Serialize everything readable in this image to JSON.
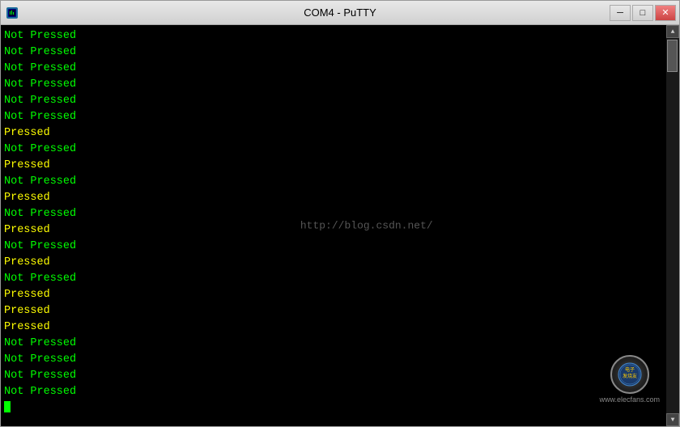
{
  "window": {
    "title": "COM4 - PuTTY",
    "icon": "putty-icon"
  },
  "titlebar": {
    "minimize_label": "─",
    "restore_label": "□",
    "close_label": "✕"
  },
  "terminal": {
    "lines": [
      {
        "type": "not-pressed",
        "text": "Not Pressed"
      },
      {
        "type": "not-pressed",
        "text": "Not Pressed"
      },
      {
        "type": "not-pressed",
        "text": "Not Pressed"
      },
      {
        "type": "not-pressed",
        "text": "Not Pressed"
      },
      {
        "type": "not-pressed",
        "text": "Not Pressed"
      },
      {
        "type": "not-pressed",
        "text": "Not Pressed"
      },
      {
        "type": "pressed",
        "text": "Pressed"
      },
      {
        "type": "not-pressed",
        "text": "Not Pressed"
      },
      {
        "type": "pressed",
        "text": "Pressed"
      },
      {
        "type": "not-pressed",
        "text": "Not Pressed"
      },
      {
        "type": "pressed",
        "text": "Pressed"
      },
      {
        "type": "not-pressed",
        "text": "Not Pressed"
      },
      {
        "type": "pressed",
        "text": "Pressed"
      },
      {
        "type": "not-pressed",
        "text": "Not Pressed"
      },
      {
        "type": "pressed",
        "text": "Pressed"
      },
      {
        "type": "not-pressed",
        "text": "Not Pressed"
      },
      {
        "type": "pressed",
        "text": "Pressed"
      },
      {
        "type": "pressed",
        "text": "Pressed"
      },
      {
        "type": "pressed",
        "text": "Pressed"
      },
      {
        "type": "not-pressed",
        "text": "Not Pressed"
      },
      {
        "type": "not-pressed",
        "text": "Not Pressed"
      },
      {
        "type": "not-pressed",
        "text": "Not Pressed"
      },
      {
        "type": "not-pressed",
        "text": "Not Pressed"
      }
    ],
    "watermark": "http://blog.csdn.net/",
    "cursor_line": ""
  },
  "bottom_watermark": {
    "site": "www.elecfans.com",
    "logo_text": "电子发烧友"
  }
}
